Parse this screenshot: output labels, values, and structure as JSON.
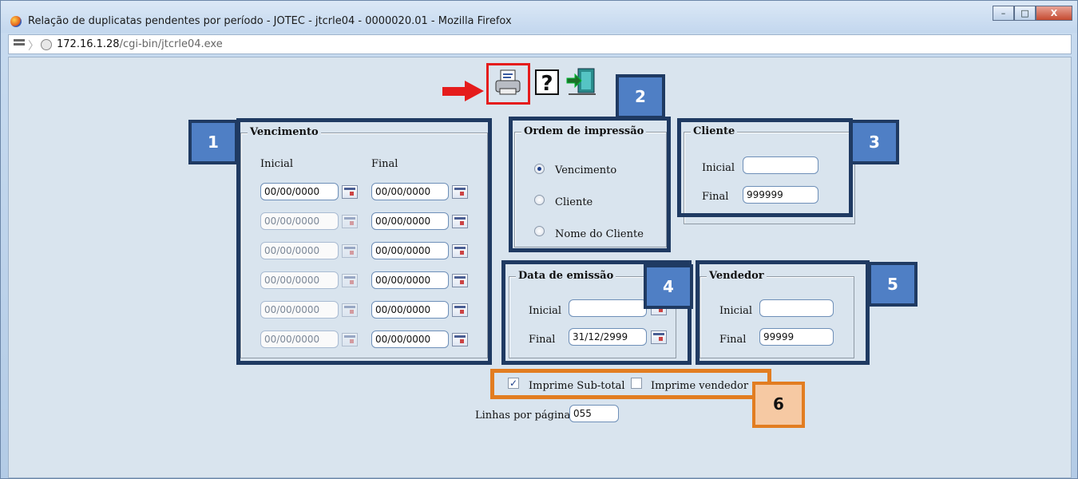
{
  "window": {
    "title": "Relação de duplicatas pendentes por período - JOTEC - jtcrle04 - 0000020.01 - Mozilla Firefox",
    "controls": [
      "–",
      "□",
      "X"
    ]
  },
  "url": {
    "host": "172.16.1.28",
    "path": "/cgi-bin/jtcrle04.exe"
  },
  "toolbar": {
    "icons": [
      "printer-icon",
      "help-icon",
      "exit-icon"
    ]
  },
  "vencimento": {
    "legend": "Vencimento",
    "col_inicial": "Inicial",
    "col_final": "Final",
    "rows": [
      {
        "inicial": "00/00/0000",
        "final": "00/00/0000"
      },
      {
        "inicial": "00/00/0000",
        "final": "00/00/0000"
      },
      {
        "inicial": "00/00/0000",
        "final": "00/00/0000"
      },
      {
        "inicial": "00/00/0000",
        "final": "00/00/0000"
      },
      {
        "inicial": "00/00/0000",
        "final": "00/00/0000"
      },
      {
        "inicial": "00/00/0000",
        "final": "00/00/0000"
      }
    ]
  },
  "ordem": {
    "legend": "Ordem de impressão",
    "options": [
      "Vencimento",
      "Cliente",
      "Nome do Cliente"
    ],
    "selected": "Vencimento"
  },
  "cliente": {
    "legend": "Cliente",
    "inicial_label": "Inicial",
    "inicial": "",
    "final_label": "Final",
    "final": "999999"
  },
  "emissao": {
    "legend": "Data de emissão",
    "inicial_label": "Inicial",
    "inicial": "",
    "final_label": "Final",
    "final": "31/12/2999"
  },
  "vendedor": {
    "legend": "Vendedor",
    "inicial_label": "Inicial",
    "inicial": "",
    "final_label": "Final",
    "final": "99999"
  },
  "opcoes": {
    "subtotal_label": "Imprime Sub-total",
    "subtotal_checked": true,
    "vendedor_label": "Imprime vendedor",
    "vendedor_checked": false
  },
  "linhas": {
    "label": "Linhas por página:",
    "value": "055"
  },
  "callouts": [
    "1",
    "2",
    "3",
    "4",
    "5",
    "6"
  ],
  "colors": {
    "callout_blue": "#4f7fc5",
    "callout_border": "#1f3a62",
    "callout_orange": "#e27d21",
    "highlight_red": "#e51c1c"
  }
}
